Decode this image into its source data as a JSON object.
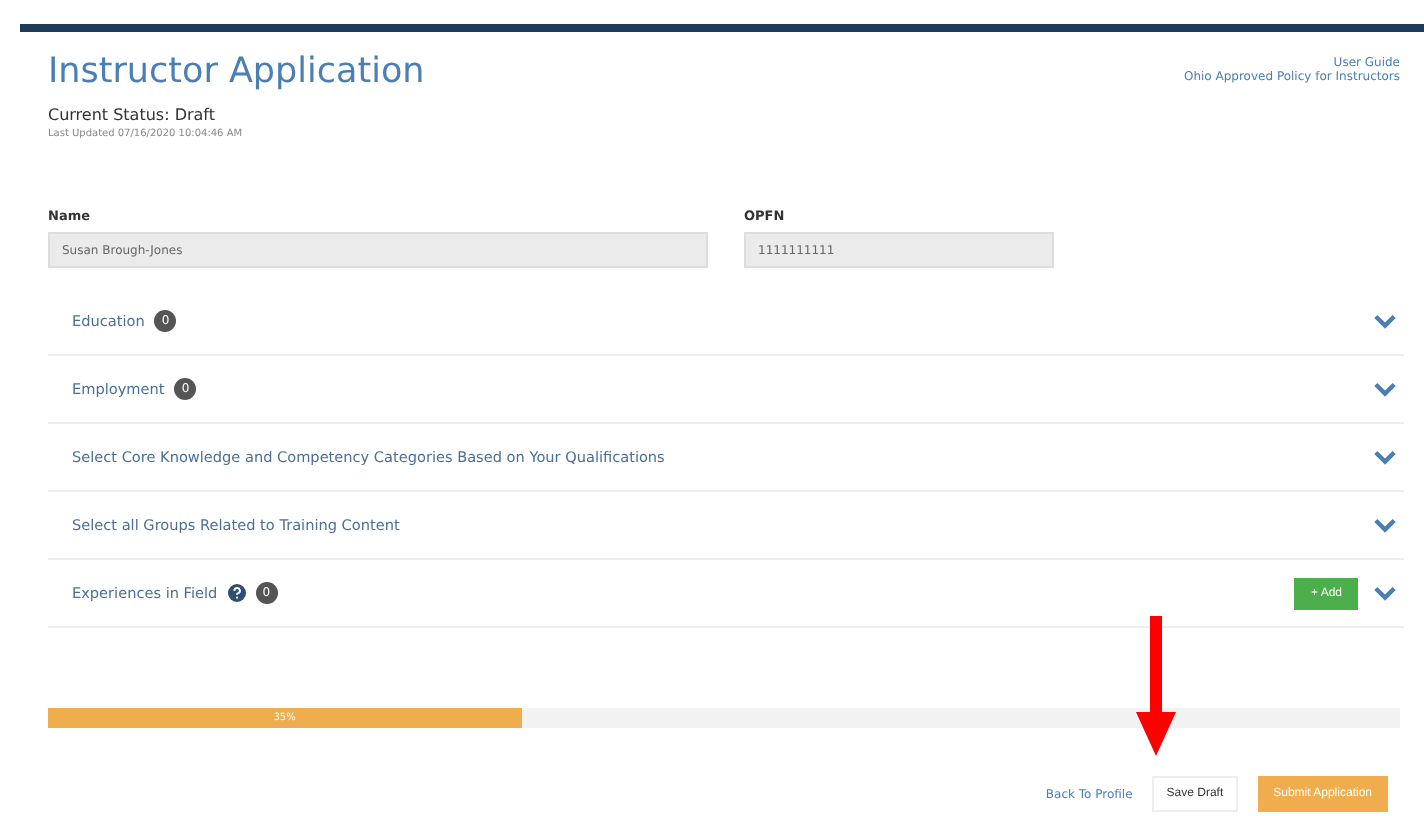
{
  "header": {
    "title": "Instructor Application",
    "status": "Current Status: Draft",
    "last_updated": "Last Updated 07/16/2020 10:04:46 AM",
    "links": [
      "User Guide",
      "Ohio Approved Policy for Instructors"
    ]
  },
  "fields": [
    {
      "label": "Name",
      "value": "Susan Brough-Jones"
    },
    {
      "label": "OPFN",
      "value": "1111111111"
    }
  ],
  "sections": [
    {
      "title": "Education",
      "help": false,
      "badge": "0"
    },
    {
      "title": "Employment",
      "help": false,
      "badge": "0"
    },
    {
      "title": "Select Core Knowledge and Competency Categories Based on Your Qualifications",
      "help": false
    },
    {
      "title": "Select all Groups Related to Training Content",
      "help": false
    },
    {
      "title": "Experiences in Field",
      "help": true,
      "badge": "0",
      "add_button": "+ Add"
    }
  ],
  "progress": {
    "level": 0.35,
    "label": "35%"
  },
  "actions": {
    "back": "Back To Profile",
    "save": "Save Draft",
    "submit": "Submit Application"
  }
}
